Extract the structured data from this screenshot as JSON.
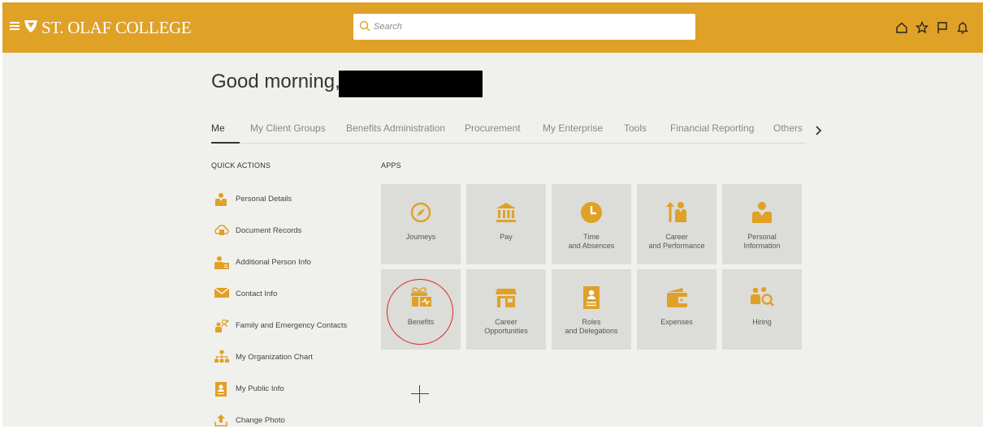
{
  "header": {
    "brand": "ST. OLAF COLLEGE",
    "search_placeholder": "Search",
    "icons": [
      "home-icon",
      "star-icon",
      "flag-icon",
      "bell-icon"
    ],
    "accent": "#e0a127"
  },
  "greeting": "Good morning,",
  "tabs": [
    {
      "label": "Me",
      "active": true
    },
    {
      "label": "My Client Groups"
    },
    {
      "label": "Benefits Administration"
    },
    {
      "label": "Procurement"
    },
    {
      "label": "My Enterprise"
    },
    {
      "label": "Tools"
    },
    {
      "label": "Financial Reporting"
    },
    {
      "label": "Others"
    }
  ],
  "quick_actions": {
    "heading": "QUICK ACTIONS",
    "items": [
      {
        "label": "Personal Details",
        "icon": "person-icon"
      },
      {
        "label": "Document Records",
        "icon": "cloud-document-icon"
      },
      {
        "label": "Additional Person Info",
        "icon": "person-card-icon"
      },
      {
        "label": "Contact Info",
        "icon": "envelope-icon"
      },
      {
        "label": "Family and Emergency Contacts",
        "icon": "family-icon"
      },
      {
        "label": "My Organization Chart",
        "icon": "org-chart-icon"
      },
      {
        "label": "My Public Info",
        "icon": "badge-icon"
      },
      {
        "label": "Change Photo",
        "icon": "upload-icon"
      }
    ]
  },
  "apps": {
    "heading": "APPS",
    "tiles": [
      {
        "label": "Journeys",
        "icon": "compass-icon"
      },
      {
        "label": "Pay",
        "icon": "bank-icon"
      },
      {
        "label": "Time and Absences",
        "icon": "clock-icon"
      },
      {
        "label": "Career and Performance",
        "icon": "career-icon"
      },
      {
        "label": "Personal Information",
        "icon": "person-icon"
      },
      {
        "label": "Benefits",
        "icon": "gift-icon"
      },
      {
        "label": "Career Opportunities",
        "icon": "storefront-icon"
      },
      {
        "label": "Roles and Delegations",
        "icon": "id-badge-icon"
      },
      {
        "label": "Expenses",
        "icon": "wallet-icon"
      },
      {
        "label": "Hiring",
        "icon": "hiring-icon"
      }
    ]
  }
}
